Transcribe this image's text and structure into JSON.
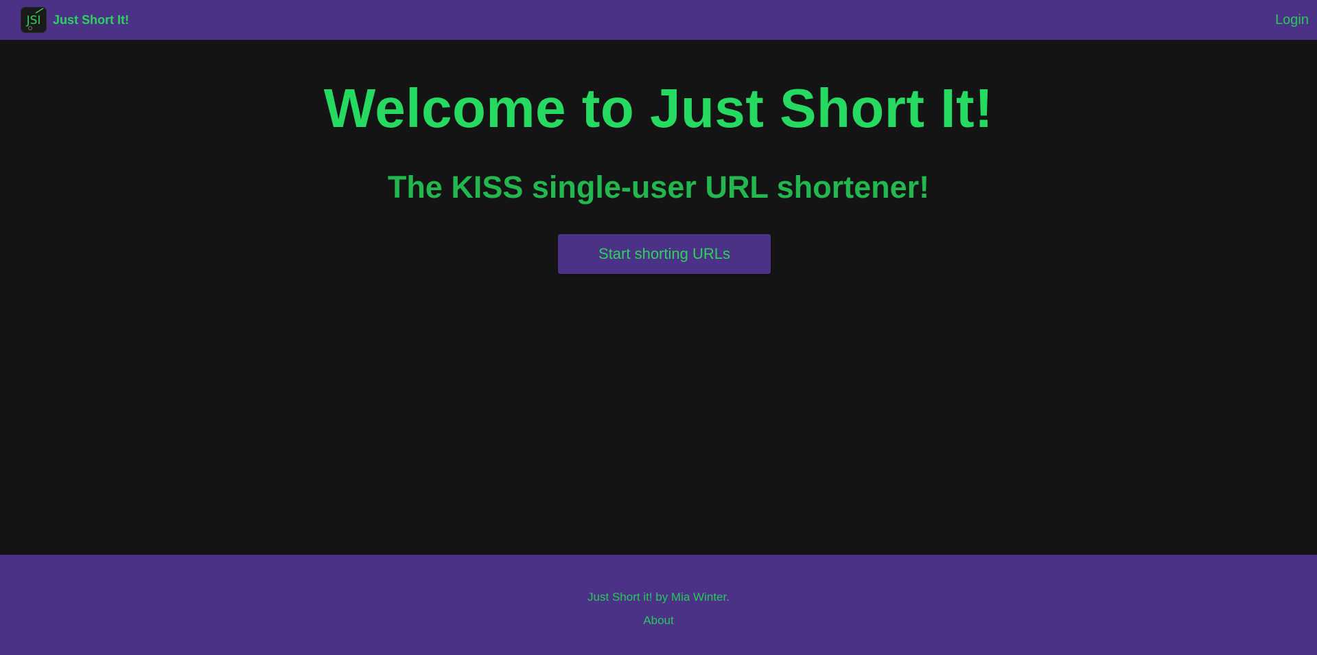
{
  "navbar": {
    "logo_icon": "jsi-logo-icon",
    "logo_text": "JSI",
    "brand_name": "Just Short It!",
    "login_label": "Login",
    "background_color": "#4b3287"
  },
  "main": {
    "title": "Welcome to Just Short It!",
    "subtitle": "The KISS single-user URL shortener!",
    "cta_label": "Start shorting URLs",
    "accent_color": "#26d960",
    "background_color": "#141414"
  },
  "footer": {
    "credit": "Just Short it! by Mia Winter.",
    "about_label": "About",
    "background_color": "#4b3287"
  }
}
